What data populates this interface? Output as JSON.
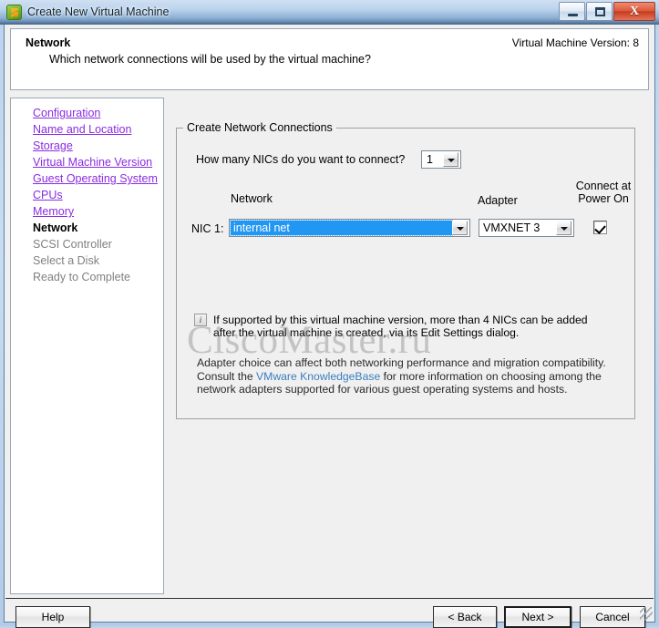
{
  "window": {
    "title": "Create New Virtual Machine",
    "icon": "vsphere-vm-icon",
    "minimize_label": "",
    "maximize_label": "",
    "close_label": "X"
  },
  "header": {
    "title": "Network",
    "subtitle": "Which network connections will be used by the virtual machine?",
    "version_label": "Virtual Machine Version: 8"
  },
  "sidebar": {
    "items": [
      {
        "label": "Configuration",
        "state": "link"
      },
      {
        "label": "Name and Location",
        "state": "link"
      },
      {
        "label": "Storage",
        "state": "link"
      },
      {
        "label": "Virtual Machine Version",
        "state": "link"
      },
      {
        "label": "Guest Operating System",
        "state": "link"
      },
      {
        "label": "CPUs",
        "state": "link"
      },
      {
        "label": "Memory",
        "state": "link"
      },
      {
        "label": "Network",
        "state": "current"
      },
      {
        "label": "SCSI Controller",
        "state": "future"
      },
      {
        "label": "Select a Disk",
        "state": "future"
      },
      {
        "label": "Ready to Complete",
        "state": "future"
      }
    ]
  },
  "main": {
    "groupbox_legend": "Create Network Connections",
    "nic_count_question": "How many NICs do you want to connect?",
    "nic_count_value": "1",
    "column_network": "Network",
    "column_adapter": "Adapter",
    "column_connect_line1": "Connect at",
    "column_connect_line2": "Power On",
    "nic_row_label": "NIC 1:",
    "network_value": "internal net",
    "adapter_value": "VMXNET 3",
    "connect_at_power_on_checked": true,
    "info_icon": "info-icon",
    "info_text": "If supported by this virtual machine version, more than 4 NICs can be added after the virtual machine is created, via its Edit Settings dialog.",
    "adapter_note_part1": "Adapter choice can affect both networking performance and migration compatibility. Consult the ",
    "adapter_note_link": "VMware KnowledgeBase",
    "adapter_note_part2": " for more information on choosing among the network adapters supported for various guest operating systems and hosts."
  },
  "watermark": {
    "text": "CiscoMaster.ru"
  },
  "footer": {
    "help_label": "Help",
    "back_label": "< Back",
    "next_label": "Next >",
    "cancel_label": "Cancel"
  },
  "colors": {
    "selection_blue": "#2196f3",
    "link_purple": "#8a2be2",
    "link_blue": "#3a7ebf",
    "title_green": "#74b32e",
    "close_red": "#c63c1e"
  }
}
